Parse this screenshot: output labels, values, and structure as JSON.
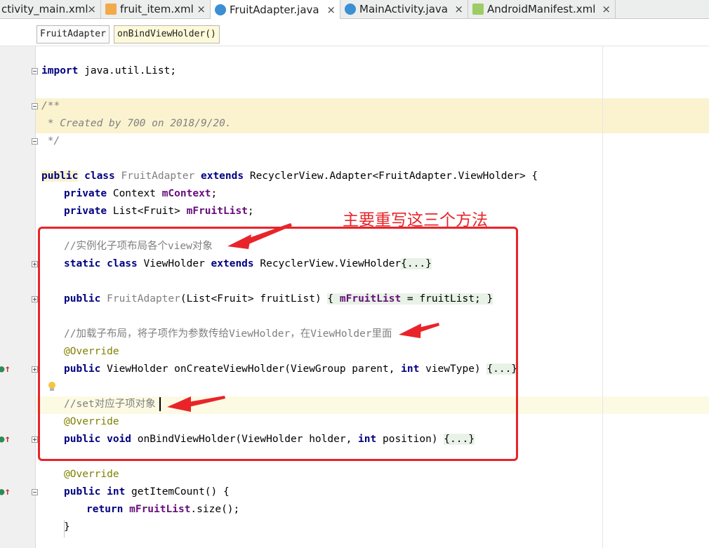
{
  "tabs": [
    {
      "label": "ctivity_main.xml",
      "type": "xml",
      "active": false
    },
    {
      "label": "fruit_item.xml",
      "type": "xml",
      "active": false
    },
    {
      "label": "FruitAdapter.java",
      "type": "java",
      "active": true
    },
    {
      "label": "MainActivity.java",
      "type": "java",
      "active": false
    },
    {
      "label": "AndroidManifest.xml",
      "type": "manifest",
      "active": false
    }
  ],
  "tab_close": "×",
  "breadcrumb": {
    "class_name": "FruitAdapter",
    "method_name": "onBindViewHolder()"
  },
  "code": {
    "import_kw": "import",
    "import_rest": " java.util.List;",
    "doc_open": "/**",
    "doc_line": " * Created by 700 on 2018/9/20.",
    "doc_close": " */",
    "class_public": "public",
    "class_class": " class ",
    "class_name": "FruitAdapter",
    "class_extends": " extends ",
    "class_super": "RecyclerView.Adapter<FruitAdapter.ViewHolder> {",
    "f1_private": "private",
    "f1_type": " Context ",
    "f1_name": "mContext",
    "f1_end": ";",
    "f2_private": "private",
    "f2_type": " List<Fruit> ",
    "f2_name": "mFruitList",
    "f2_end": ";",
    "c1": "//实例化子项布局各个view对象",
    "vh_kw": "static class",
    "vh_name": " ViewHolder ",
    "vh_extends": "extends",
    "vh_super": " RecyclerView.ViewHolder",
    "vh_fold": "{...}",
    "ctor_public": "public",
    "ctor_name": " FruitAdapter",
    "ctor_params": "(List<Fruit> fruitList) ",
    "ctor_open": "{ ",
    "ctor_field": "mFruitList",
    "ctor_assign": " = fruitList; ",
    "ctor_close": "}",
    "c2": "//加载子布局，将子项作为参数传给ViewHolder，在ViewHolder里面",
    "annotation": "@Override",
    "m1_public": "public",
    "m1_sig": " ViewHolder onCreateViewHolder(ViewGroup parent, ",
    "m1_int": "int",
    "m1_end": " viewType) ",
    "fold": "{...}",
    "c3": "//set对应子项对象",
    "m2_public": "public void",
    "m2_sig": " onBindViewHolder(ViewHolder holder, ",
    "m2_int": "int",
    "m2_end": " position) ",
    "m3_public": "public int",
    "m3_sig": " getItemCount() {",
    "ret_kw": "return",
    "ret_field": " mFruitList",
    "ret_end": ".size();",
    "close_brace": "}"
  },
  "callout_label": "主要重写这三个方法",
  "colors": {
    "callout": "#e8242a",
    "keyword": "#000080",
    "field": "#660e7a",
    "annotation": "#808000",
    "comment": "#808080"
  }
}
